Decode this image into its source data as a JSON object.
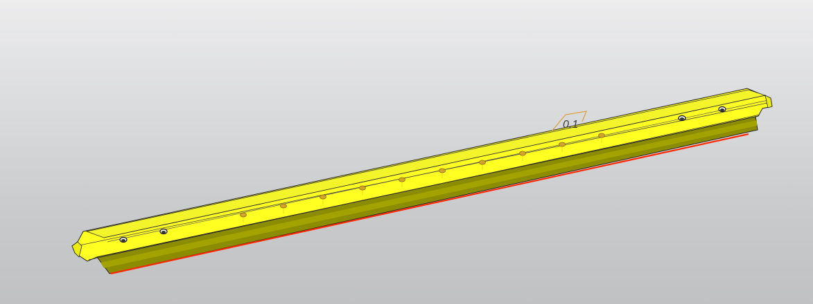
{
  "viewport": {
    "background_color": "#c6c7c9"
  },
  "model": {
    "part_color": "#ffff22",
    "shade_color": "#8c8c00",
    "edge_color": "#222222",
    "selected_edge_color": "#ff2a00",
    "hole_color": "#d4a52a",
    "through_hole_count": 4,
    "center_hole_count": 10
  },
  "annotation": {
    "text": "0.1",
    "color": "#d9a03a"
  }
}
